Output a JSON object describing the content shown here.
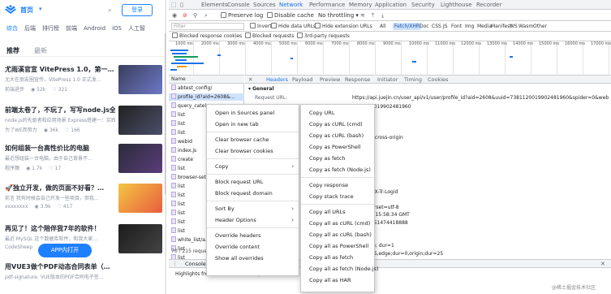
{
  "mobile": {
    "brand": "首页",
    "brand_caret": "▾",
    "login": "登录",
    "categories": [
      "综合",
      "后端",
      "排行榜",
      "前端",
      "Android",
      "iOS",
      "人工智"
    ],
    "feed_tabs": [
      "推荐",
      "最新"
    ],
    "articles": [
      {
        "title": "尤雨溪官宣 VitePress 1.0，第一…",
        "desc": "尤大在朋友圈宣传，VitePress 1.0 正式发…",
        "author": "前端进步",
        "views": "52k",
        "likes": "321"
      },
      {
        "title": "前端太卷了，不玩了，写写node.js全栈涨工资，赶…",
        "desc": "node.js的先驱者和应用场景 Express搭建一：实践与玩家深爱…",
        "author": "为了WE而努力",
        "views": "36k",
        "likes": "166"
      },
      {
        "title": "如何组装一台高性价比的电脑",
        "desc": "最近想组装一台电脑，由于自己背景不…",
        "author": "程序猿",
        "views": "1.7k",
        "likes": "17"
      },
      {
        "title": "🚀独立开发，做的页面不好看？…",
        "desc": "前言 我有时候会自己开发一些项目，但我…",
        "author": "xxxxxxxx",
        "views": "3.9k",
        "likes": "417"
      },
      {
        "title": "再见了！这个陪伴我7年的软件！",
        "desc": "最近 MySQL 这个数据库软件，和我大家…",
        "author": "CodeSheep",
        "views": "",
        "likes": ""
      },
      {
        "title": "用VUE3做个PDF动态合同表单（…",
        "desc": "pdf-signature: VUE版本的PDF合同电子签…",
        "author": "",
        "views": "",
        "likes": ""
      }
    ],
    "app_button": "APP内打开"
  },
  "devtools": {
    "top_tabs": [
      "Elements",
      "Console",
      "Sources",
      "Network",
      "Performance",
      "Memory",
      "Application",
      "Security",
      "Lighthouse",
      "Recorder"
    ],
    "active_tab": "Network",
    "toolbar": {
      "preserve_log": "Preserve log",
      "disable_cache": "Disable cache",
      "throttle": "No throttling"
    },
    "filter": {
      "placeholder": "Filter",
      "invert": "Invert",
      "hide_data_urls": "Hide data URLs",
      "hide_ext_urls": "Hide extension URLs",
      "types": [
        "All",
        "Fetch/XHR",
        "Doc",
        "CSS",
        "JS",
        "Font",
        "Img",
        "Media",
        "Manifest",
        "WS",
        "Wasm",
        "Other"
      ],
      "active_type": "Fetch/XHR"
    },
    "block": {
      "blocked_cookies": "Blocked response cookies",
      "blocked_requests": "Blocked requests",
      "third_party": "3rd-party requests"
    },
    "overview_ticks": [
      "1000 ms",
      "2000 ms",
      "3000 ms",
      "4000 ms",
      "5000 ms",
      "6000 ms",
      "7000 ms",
      "8000 ms",
      "9000 ms",
      "10000 ms",
      "11000 ms",
      "12000 ms",
      "13000 ms",
      "14000 ms",
      "15000 ms",
      "16000 ms",
      "17000 ms"
    ],
    "requests": {
      "header": "Name",
      "items": [
        "abtest_config/",
        "profile_id?aid=2608&...",
        "query_catel...",
        "list",
        "list",
        "list",
        "webid",
        "index.js",
        "create",
        "list",
        "browser-sett...",
        "list",
        "list",
        "list",
        "list",
        "list",
        "list",
        "white_list/a...",
        "list",
        "list"
      ],
      "status": "70 / 215 requests"
    },
    "detail": {
      "tabs": [
        "Headers",
        "Payload",
        "Preview",
        "Response",
        "Initiator",
        "Timing",
        "Cookies"
      ],
      "active": "Headers",
      "section": "▾ General",
      "request_url_label": "Request URL:",
      "request_url": "https://api.juejin.cn/user_api/v1/user/profile_id?aid=2608&uuid=7381120019902481960&spider=0&web_id",
      "lines": [
        "7381120019902481960",
        "",
        ".b8:443",
        "",
        ".in-when-cross-origin",
        "",
        "",
        "",
        "",
        "gin.cn",
        "",
        "PF-Token,X-Tr-Logid",
        "",
        "json; charset=utf-8",
        "Jun 2024 15:58:34 GMT",
        "171855351474418888",
        "",
        "",
        "=iLtt_age; dur=1",
        "dex=MISS,edge;dur=0,origin;dur=25"
      ]
    },
    "drawer": {
      "tab": "Console",
      "body": "Highlights from the Chrome 125 update"
    }
  },
  "menu1": {
    "items": [
      "Open in Sources panel",
      "Open in new tab",
      "",
      "Clear browser cache",
      "Clear browser cookies",
      "",
      "Copy",
      "",
      "Block request URL",
      "Block request domain",
      "",
      "Sort By",
      "Header Options",
      "",
      "Override headers",
      "Override content",
      "Show all overrides"
    ]
  },
  "menu2": {
    "items": [
      "Copy URL",
      "Copy as cURL (cmd)",
      "Copy as cURL (bash)",
      "Copy as PowerShell",
      "Copy as fetch",
      "Copy as fetch (Node.js)",
      "",
      "Copy response",
      "Copy stack trace",
      "",
      "Copy all URLs",
      "Copy all as cURL (cmd)",
      "Copy all as cURL (bash)",
      "Copy all as PowerShell",
      "Copy all as fetch",
      "Copy all as fetch (Node.js)",
      "Copy all as HAR"
    ]
  },
  "watermark": "@稀土掘金技术社区"
}
